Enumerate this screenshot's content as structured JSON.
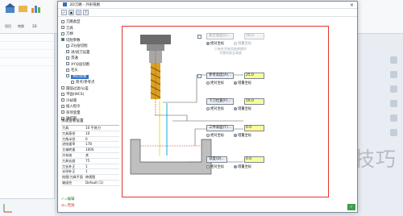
{
  "app": {
    "ribbon_labels": [
      "项目",
      "转换",
      "2D"
    ],
    "left_tree_rows": [
      "",
      "",
      "",
      "",
      "",
      "",
      "",
      "",
      ""
    ],
    "watermark": "软件技巧"
  },
  "dialog": {
    "title": "2D刀路 - 外形铣削",
    "close": "×",
    "toolbar": [
      "✓",
      "▣",
      "▢",
      "?"
    ],
    "tree": [
      {
        "label": "刀路类型",
        "level": 1,
        "checked": false,
        "selected": false
      },
      {
        "label": "刀具",
        "level": 1,
        "checked": false,
        "selected": false
      },
      {
        "label": "刀柄",
        "level": 1,
        "checked": false,
        "selected": false
      },
      {
        "label": "切削参数",
        "level": 1,
        "checked": true,
        "selected": false
      },
      {
        "label": "Z分层切削",
        "level": 2,
        "checked": false,
        "selected": false
      },
      {
        "label": "进/退刀设置",
        "level": 2,
        "checked": false,
        "selected": false
      },
      {
        "label": "贯通",
        "level": 2,
        "checked": false,
        "selected": false
      },
      {
        "label": "XY分层切削",
        "level": 2,
        "checked": false,
        "selected": false
      },
      {
        "label": "毛头",
        "level": 2,
        "checked": false,
        "selected": false
      },
      {
        "label": "共同参数",
        "level": 2,
        "checked": false,
        "selected": true
      },
      {
        "label": "原点/参考点",
        "level": 3,
        "checked": false,
        "selected": false
      },
      {
        "label": "圆弧过滤/公差",
        "level": 1,
        "checked": false,
        "selected": false
      },
      {
        "label": "平面(WCS)",
        "level": 1,
        "checked": false,
        "selected": false
      },
      {
        "label": "冷却液",
        "level": 1,
        "checked": false,
        "selected": false
      },
      {
        "label": "插入指令",
        "level": 1,
        "checked": false,
        "selected": false
      },
      {
        "label": "杂项变量",
        "level": 1,
        "checked": false,
        "selected": false
      },
      {
        "label": "轴控制",
        "level": 1,
        "checked": false,
        "selected": false
      }
    ],
    "quick_settings_title": "快速查看设置",
    "quick_settings": [
      {
        "k": "刀具",
        "v": "10 平底刀"
      },
      {
        "k": "刀具直径",
        "v": "10"
      },
      {
        "k": "刀角半径",
        "v": "0"
      },
      {
        "k": "进给速率",
        "v": "178"
      },
      {
        "k": "主轴转速",
        "v": "1000"
      },
      {
        "k": "冷却液",
        "v": "关"
      },
      {
        "k": "刀具长度",
        "v": "75"
      },
      {
        "k": "刀长补正",
        "v": "1"
      },
      {
        "k": "半径补正",
        "v": "1"
      },
      {
        "k": "绘图/刀具平面",
        "v": "俯视图"
      },
      {
        "k": "轴组合",
        "v": "Default (1)"
      }
    ],
    "status_ok": "✓=编辑",
    "status_disabled": "⊘=无效",
    "ok_label": "✓"
  },
  "params": {
    "safe_height": {
      "label": "安全高度(L)...",
      "value": "50.0",
      "abs": "绝对坐标",
      "inc": "增量坐标",
      "note": "只有在开始及结束操作\n才使用安全高度",
      "enabled": false,
      "abs_on": true
    },
    "reference_height": {
      "label": "参考高度(A)...",
      "value": "25.0",
      "abs": "绝对坐标",
      "inc": "增量坐标",
      "enabled": true,
      "abs_on": false
    },
    "feed_plane": {
      "label": "下刀位置(F)...",
      "value": "10.0",
      "abs": "绝对坐标",
      "inc": "增量坐标",
      "enabled": true,
      "abs_on": false
    },
    "top_of_stock": {
      "label": "工件表面(T)...",
      "value": "0.0",
      "abs": "绝对坐标",
      "inc": "增量坐标",
      "enabled": true,
      "abs_on": false
    },
    "depth": {
      "label": "深度(D)...",
      "value": "0.0",
      "abs": "绝对坐标",
      "inc": "增量坐标",
      "enabled": true,
      "abs_on": false
    }
  }
}
